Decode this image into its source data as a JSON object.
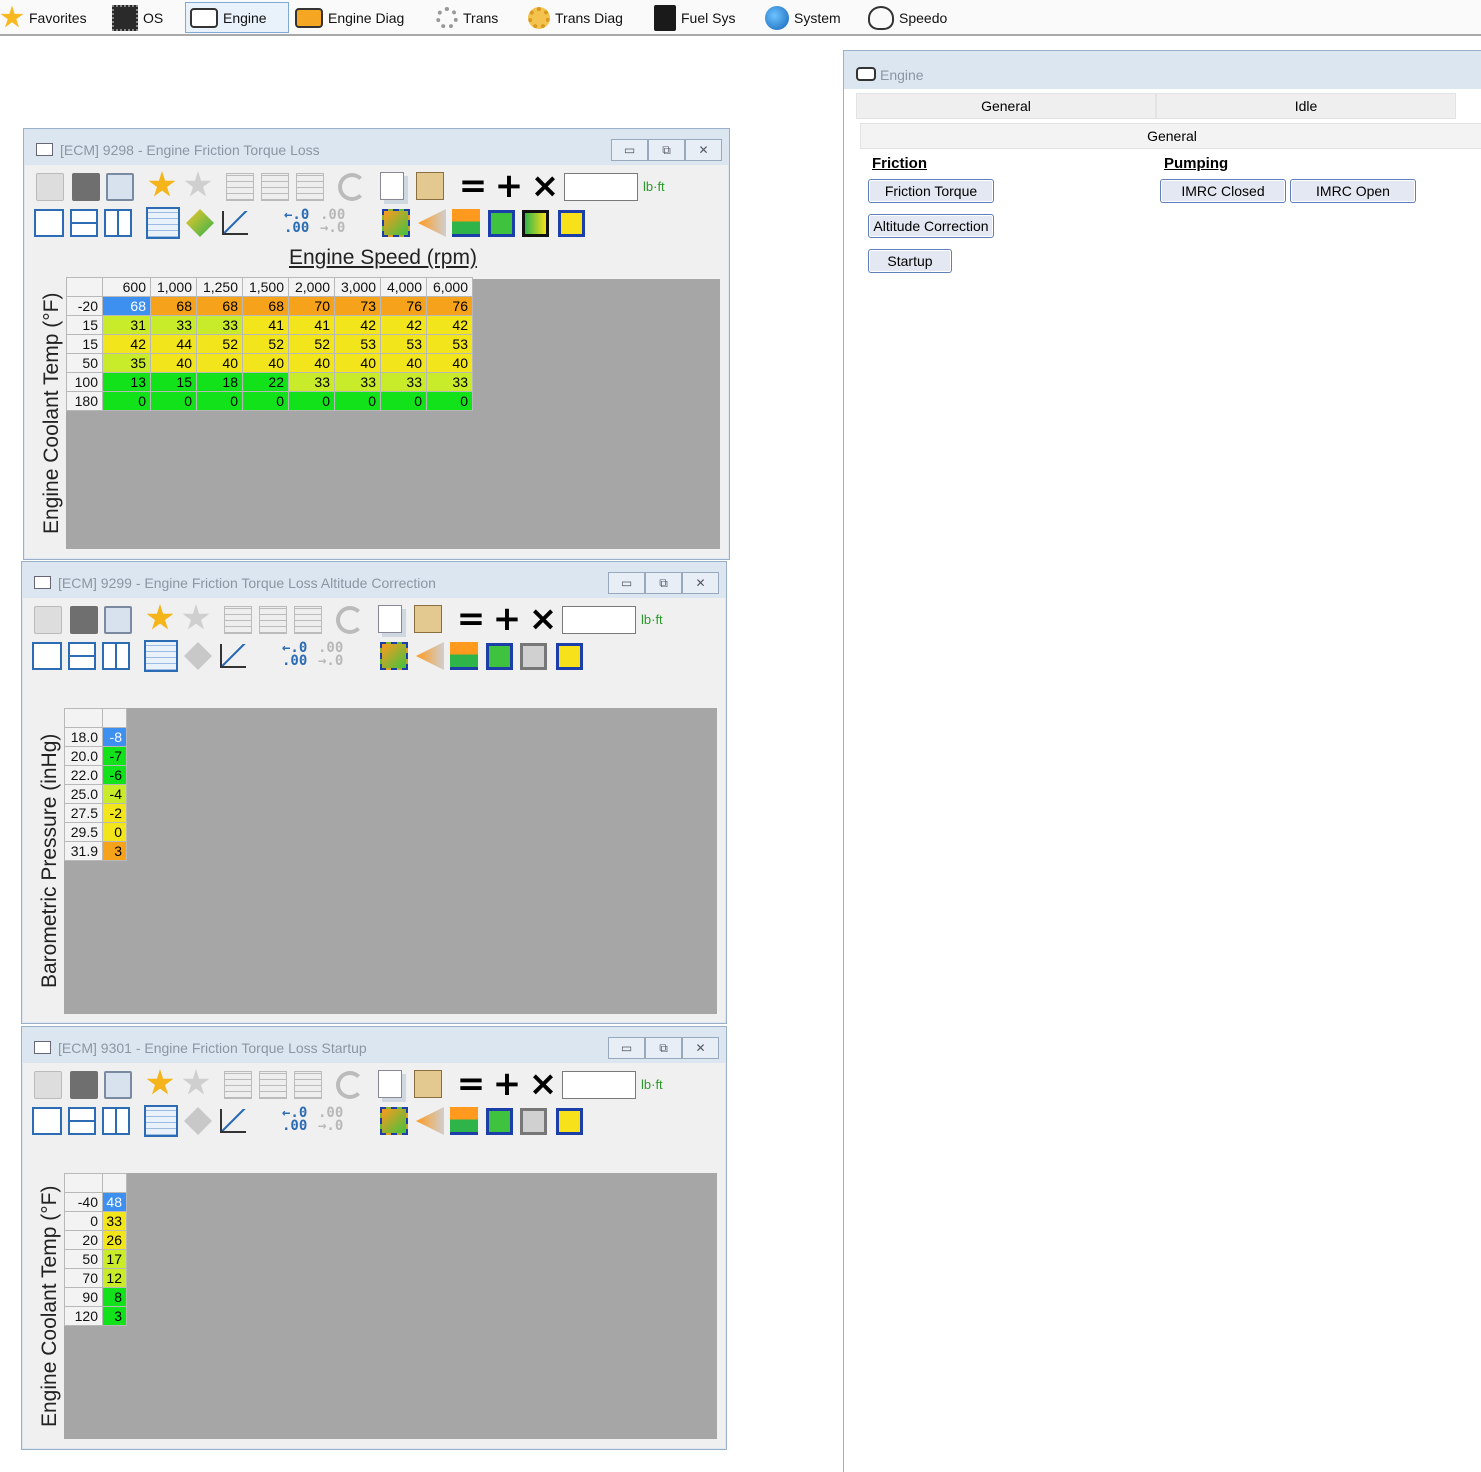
{
  "nav": {
    "items": [
      {
        "label": "Favorites",
        "icon": "star-icon"
      },
      {
        "label": "OS",
        "icon": "chip-icon"
      },
      {
        "label": "Engine",
        "icon": "engine-icon"
      },
      {
        "label": "Engine Diag",
        "icon": "engine-diag-icon"
      },
      {
        "label": "Trans",
        "icon": "gear-icon"
      },
      {
        "label": "Trans Diag",
        "icon": "gear-diag-icon"
      },
      {
        "label": "Fuel Sys",
        "icon": "fuel-pump-icon"
      },
      {
        "label": "System",
        "icon": "globe-icon"
      },
      {
        "label": "Speedo",
        "icon": "gauge-icon"
      }
    ],
    "active": "Engine"
  },
  "windows": [
    {
      "title": "[ECM] 9298 - Engine Friction Torque Loss",
      "unit": "lb·ft",
      "x_axis_label": "Engine Speed (rpm)",
      "y_axis_label": "Engine Coolant Temp (°F)",
      "columns": [
        "600",
        "1,000",
        "1,250",
        "1,500",
        "2,000",
        "3,000",
        "4,000",
        "6,000"
      ],
      "rows": [
        {
          "header": "-20",
          "cells": [
            "68",
            "68",
            "68",
            "68",
            "70",
            "73",
            "76",
            "76"
          ]
        },
        {
          "header": "15",
          "cells": [
            "31",
            "33",
            "33",
            "41",
            "41",
            "42",
            "42",
            "42"
          ]
        },
        {
          "header": "15",
          "cells": [
            "42",
            "44",
            "52",
            "52",
            "52",
            "53",
            "53",
            "53"
          ]
        },
        {
          "header": "50",
          "cells": [
            "35",
            "40",
            "40",
            "40",
            "40",
            "40",
            "40",
            "40"
          ]
        },
        {
          "header": "100",
          "cells": [
            "13",
            "15",
            "18",
            "22",
            "33",
            "33",
            "33",
            "33"
          ]
        },
        {
          "header": "180",
          "cells": [
            "0",
            "0",
            "0",
            "0",
            "0",
            "0",
            "0",
            "0"
          ]
        }
      ]
    },
    {
      "title": "[ECM] 9299 - Engine Friction Torque Loss Altitude Correction",
      "unit": "lb·ft",
      "y_axis_label": "Barometric Pressure (inHg)",
      "rows": [
        {
          "header": "18.0",
          "value": "-8"
        },
        {
          "header": "20.0",
          "value": "-7"
        },
        {
          "header": "22.0",
          "value": "-6"
        },
        {
          "header": "25.0",
          "value": "-4"
        },
        {
          "header": "27.5",
          "value": "-2"
        },
        {
          "header": "29.5",
          "value": "0"
        },
        {
          "header": "31.9",
          "value": "3"
        }
      ]
    },
    {
      "title": "[ECM] 9301 - Engine Friction Torque Loss Startup",
      "unit": "lb·ft",
      "y_axis_label": "Engine Coolant Temp (°F)",
      "rows": [
        {
          "header": "-40",
          "value": "48"
        },
        {
          "header": "0",
          "value": "33"
        },
        {
          "header": "20",
          "value": "26"
        },
        {
          "header": "50",
          "value": "17"
        },
        {
          "header": "70",
          "value": "12"
        },
        {
          "header": "90",
          "value": "8"
        },
        {
          "header": "120",
          "value": "3"
        }
      ]
    }
  ],
  "engine_panel": {
    "title": "Engine",
    "tabs": [
      "General",
      "Idle"
    ],
    "subtab": "General",
    "friction": {
      "heading": "Friction",
      "buttons": [
        "Friction Torque",
        "Altitude Correction",
        "Startup"
      ]
    },
    "pumping": {
      "heading": "Pumping",
      "buttons": [
        "IMRC Closed",
        "IMRC Open"
      ]
    }
  },
  "colors": {
    "cell_blue": "#3d8ff0",
    "cell_orange": "#f7a21b",
    "cell_yellow": "#f2e51c",
    "cell_yellowgreen": "#c8ec2a",
    "cell_green": "#12e21a"
  }
}
